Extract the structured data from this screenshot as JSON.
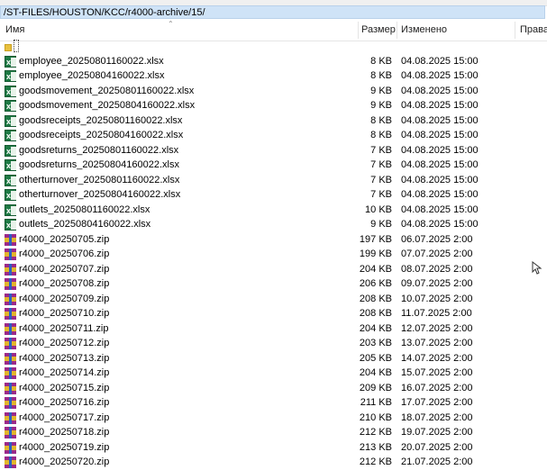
{
  "path": "/ST-FILES/HOUSTON/KCC/r4000-archive/15/",
  "columns": {
    "name": "Имя",
    "size": "Размер",
    "modified": "Изменено",
    "rights": "Права"
  },
  "parent_dir": "..",
  "files": [
    {
      "name": "employee_20250801160022.xlsx",
      "size": "8 KB",
      "modified": "04.08.2025 15:00",
      "type": "xlsx"
    },
    {
      "name": "employee_20250804160022.xlsx",
      "size": "8 KB",
      "modified": "04.08.2025 15:00",
      "type": "xlsx"
    },
    {
      "name": "goodsmovement_20250801160022.xlsx",
      "size": "9 KB",
      "modified": "04.08.2025 15:00",
      "type": "xlsx"
    },
    {
      "name": "goodsmovement_20250804160022.xlsx",
      "size": "9 KB",
      "modified": "04.08.2025 15:00",
      "type": "xlsx"
    },
    {
      "name": "goodsreceipts_20250801160022.xlsx",
      "size": "8 KB",
      "modified": "04.08.2025 15:00",
      "type": "xlsx"
    },
    {
      "name": "goodsreceipts_20250804160022.xlsx",
      "size": "8 KB",
      "modified": "04.08.2025 15:00",
      "type": "xlsx"
    },
    {
      "name": "goodsreturns_20250801160022.xlsx",
      "size": "7 KB",
      "modified": "04.08.2025 15:00",
      "type": "xlsx"
    },
    {
      "name": "goodsreturns_20250804160022.xlsx",
      "size": "7 KB",
      "modified": "04.08.2025 15:00",
      "type": "xlsx"
    },
    {
      "name": "otherturnover_20250801160022.xlsx",
      "size": "7 KB",
      "modified": "04.08.2025 15:00",
      "type": "xlsx"
    },
    {
      "name": "otherturnover_20250804160022.xlsx",
      "size": "7 KB",
      "modified": "04.08.2025 15:00",
      "type": "xlsx"
    },
    {
      "name": "outlets_20250801160022.xlsx",
      "size": "10 KB",
      "modified": "04.08.2025 15:00",
      "type": "xlsx"
    },
    {
      "name": "outlets_20250804160022.xlsx",
      "size": "9 KB",
      "modified": "04.08.2025 15:00",
      "type": "xlsx"
    },
    {
      "name": "r4000_20250705.zip",
      "size": "197 KB",
      "modified": "06.07.2025 2:00",
      "type": "zip"
    },
    {
      "name": "r4000_20250706.zip",
      "size": "199 KB",
      "modified": "07.07.2025 2:00",
      "type": "zip"
    },
    {
      "name": "r4000_20250707.zip",
      "size": "204 KB",
      "modified": "08.07.2025 2:00",
      "type": "zip"
    },
    {
      "name": "r4000_20250708.zip",
      "size": "206 KB",
      "modified": "09.07.2025 2:00",
      "type": "zip"
    },
    {
      "name": "r4000_20250709.zip",
      "size": "208 KB",
      "modified": "10.07.2025 2:00",
      "type": "zip"
    },
    {
      "name": "r4000_20250710.zip",
      "size": "208 KB",
      "modified": "11.07.2025 2:00",
      "type": "zip"
    },
    {
      "name": "r4000_20250711.zip",
      "size": "204 KB",
      "modified": "12.07.2025 2:00",
      "type": "zip"
    },
    {
      "name": "r4000_20250712.zip",
      "size": "203 KB",
      "modified": "13.07.2025 2:00",
      "type": "zip"
    },
    {
      "name": "r4000_20250713.zip",
      "size": "205 KB",
      "modified": "14.07.2025 2:00",
      "type": "zip"
    },
    {
      "name": "r4000_20250714.zip",
      "size": "204 KB",
      "modified": "15.07.2025 2:00",
      "type": "zip"
    },
    {
      "name": "r4000_20250715.zip",
      "size": "209 KB",
      "modified": "16.07.2025 2:00",
      "type": "zip"
    },
    {
      "name": "r4000_20250716.zip",
      "size": "211 KB",
      "modified": "17.07.2025 2:00",
      "type": "zip"
    },
    {
      "name": "r4000_20250717.zip",
      "size": "210 KB",
      "modified": "18.07.2025 2:00",
      "type": "zip"
    },
    {
      "name": "r4000_20250718.zip",
      "size": "212 KB",
      "modified": "19.07.2025 2:00",
      "type": "zip"
    },
    {
      "name": "r4000_20250719.zip",
      "size": "213 KB",
      "modified": "20.07.2025 2:00",
      "type": "zip"
    },
    {
      "name": "r4000_20250720.zip",
      "size": "212 KB",
      "modified": "21.07.2025 2:00",
      "type": "zip"
    }
  ]
}
